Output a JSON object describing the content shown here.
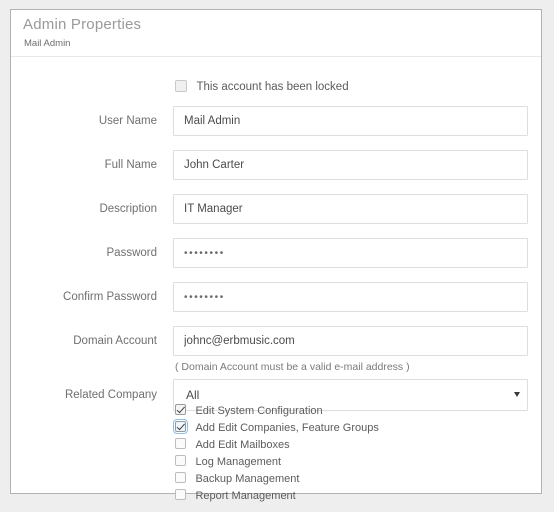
{
  "panel": {
    "title": "Admin Properties",
    "subtitle": "Mail Admin"
  },
  "lock": {
    "label": "This account has been locked",
    "checked": false
  },
  "fields": [
    {
      "label": "User Name",
      "value": "Mail Admin",
      "type": "text"
    },
    {
      "label": "Full Name",
      "value": "John Carter",
      "type": "text"
    },
    {
      "label": "Description",
      "value": "IT Manager",
      "type": "text"
    },
    {
      "label": "Password",
      "value": "••••••••",
      "type": "password"
    },
    {
      "label": "Confirm Password",
      "value": "••••••••",
      "type": "password"
    },
    {
      "label": "Domain Account",
      "value": "johnc@erbmusic.com",
      "type": "text"
    }
  ],
  "domain_hint": "( Domain Account must be a valid e-mail address )",
  "related_company": {
    "label": "Related Company",
    "selected": "All",
    "caret": "chevron-down-icon"
  },
  "permissions": [
    {
      "label": "Edit System Configuration",
      "checked": true,
      "focused": false
    },
    {
      "label": "Add Edit Companies, Feature Groups",
      "checked": true,
      "focused": true
    },
    {
      "label": "Add Edit Mailboxes",
      "checked": false,
      "focused": false
    },
    {
      "label": "Log Management",
      "checked": false,
      "focused": false
    },
    {
      "label": "Backup Management",
      "checked": false,
      "focused": false
    },
    {
      "label": "Report Management",
      "checked": false,
      "focused": false
    }
  ],
  "colors": {
    "page_background": "#eeeeee",
    "panel_border": "#b3b3b3",
    "title_text": "#9a9a9a",
    "label_text": "#6f6f6f",
    "value_text": "#4c4c4c",
    "input_border": "#dedede",
    "focus_outline": "#8fbfe8"
  }
}
